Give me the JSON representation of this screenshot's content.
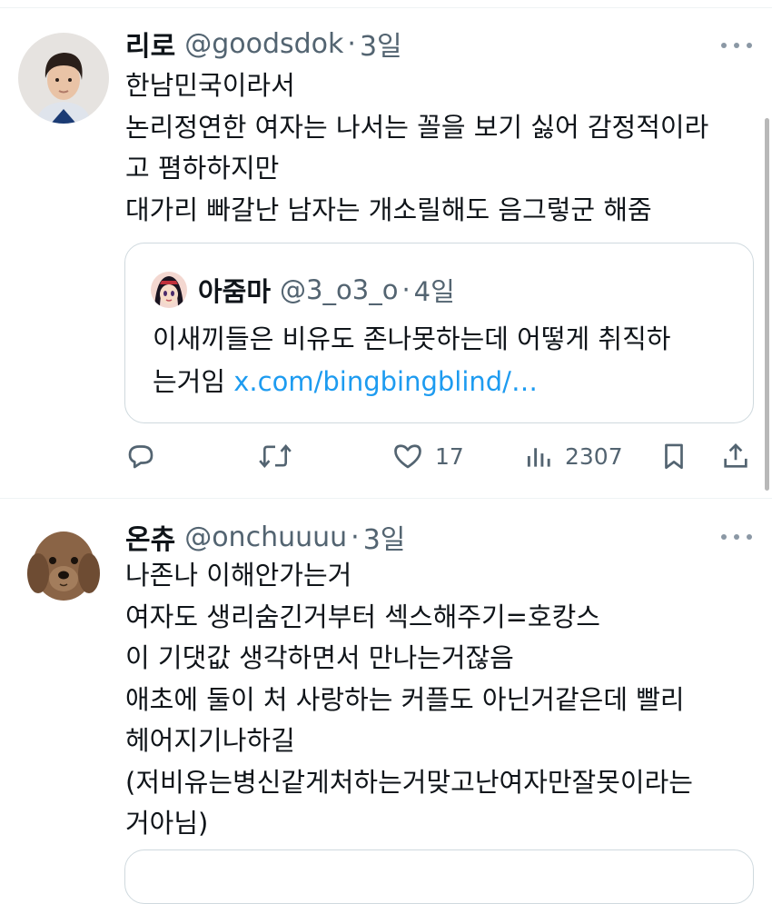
{
  "tweets": [
    {
      "name": "리로",
      "handle": "@goodsdok",
      "dot": "·",
      "time": "3일",
      "avatar_icon": "boy-profile-photo",
      "lines": [
        "한남민국이라서",
        "논리정연한 여자는 나서는 꼴을 보기 싫어 감정적이라",
        "고 폄하하지만",
        "대가리 빠갈난 남자는 개소릴해도 음그렇군 해줌"
      ],
      "quote": {
        "name": "아줌마",
        "handle": "@3_o3_o",
        "dot": "·",
        "time": "4일",
        "avatar_icon": "anime-character-avatar",
        "line1": "이새끼들은 비유도 존나못하는데 어떻게 취직하",
        "line2_text": "는거임 ",
        "link": "x.com/bingbingblind/…"
      },
      "actions": {
        "reply_icon": "reply-icon",
        "retweet_icon": "retweet-icon",
        "like_icon": "heart-icon",
        "like_count": "17",
        "views_icon": "views-icon",
        "views_count": "2307",
        "bookmark_icon": "bookmark-icon",
        "share_icon": "share-icon"
      }
    },
    {
      "name": "온츄",
      "handle": "@onchuuuu",
      "dot": "·",
      "time": "3일",
      "avatar_icon": "dog-profile-photo",
      "lines": [
        "나존나 이해안가는거",
        "여자도 생리숨긴거부터 섹스해주기=호캉스",
        "이 기댓값 생각하면서 만나는거잖음",
        "애초에 둘이 처 사랑하는 커플도 아닌거같은데 빨리",
        "헤어지기나하길",
        "(저비유는병신같게처하는거맞고난여자만잘못이라는",
        "거아님)"
      ]
    }
  ],
  "colors": {
    "text": "#0f1419",
    "secondary": "#536471",
    "link": "#1d9bf0",
    "border": "#cfd9de"
  }
}
